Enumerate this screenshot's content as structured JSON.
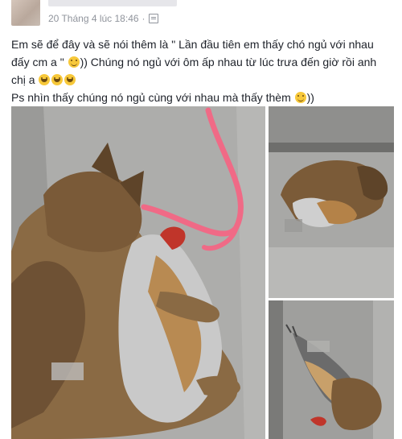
{
  "post": {
    "timestamp": "20 Tháng 4 lúc 18:46",
    "separator": "·",
    "privacy_icon": "friends-icon",
    "text_lines": {
      "p1_a": "Em sẽ để đây và sẽ nói thêm là \" Lần đầu tiên em thấy chó ngủ với nhau",
      "p1_b": "đấy cm a \"",
      "p1_c": ")) Chúng nó ngủ với ôm ấp nhau từ lúc trưa đến giờ rồi anh",
      "p1_d": "chị a",
      "p2_a": "Ps nhìn thấy chúng nó ngủ cùng với nhau mà thấy thèm",
      "p2_b": "))"
    },
    "emojis": [
      "smile-emoji",
      "laugh-emoji",
      "laugh-emoji",
      "laugh-emoji",
      "smile-emoji"
    ]
  },
  "photos": [
    {
      "name": "photo-dog-hugging-rooster",
      "description_icon": "photo"
    },
    {
      "name": "photo-dog-rooster-top"
    },
    {
      "name": "photo-dog-rooster-bottom"
    }
  ],
  "colors": {
    "text": "#1d2129",
    "meta": "#90949c",
    "rope": "#f06a86"
  }
}
